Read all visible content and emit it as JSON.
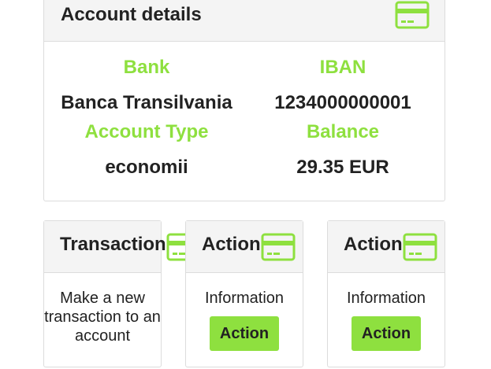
{
  "colors": {
    "accent": "#8ee03f",
    "label": "#8ee03f",
    "header_bg": "#f4f4f4",
    "border": "#dcdcdc"
  },
  "account": {
    "title": "Account details",
    "icon": "credit-card-icon",
    "fields": [
      {
        "label": "Bank",
        "value": "Banca Transilvania"
      },
      {
        "label": "IBAN",
        "value": "1234000000001"
      },
      {
        "label": "Account Type",
        "value": "economii"
      },
      {
        "label": "Balance",
        "value": "29.35 EUR"
      }
    ]
  },
  "cards": [
    {
      "title": "Transaction",
      "icon": "credit-card-icon",
      "text": "Make a new transaction to an account"
    },
    {
      "title": "Action",
      "icon": "credit-card-icon",
      "text": "Information",
      "button": "Action"
    },
    {
      "title": "Action",
      "icon": "credit-card-icon",
      "text": "Information",
      "button": "Action"
    }
  ]
}
